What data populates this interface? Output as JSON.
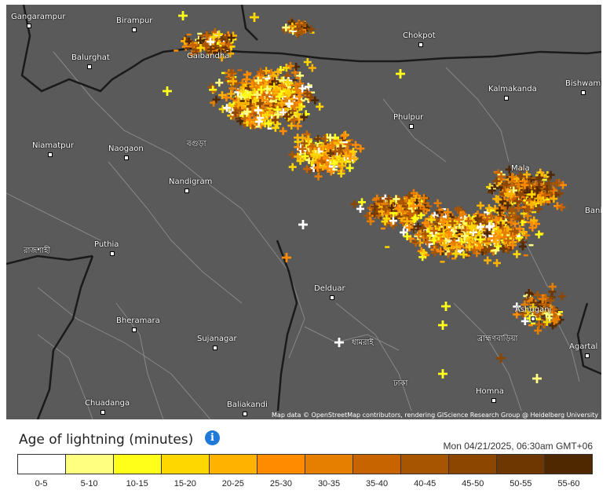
{
  "map": {
    "attribution": "Map data © OpenStreetMap contributors, rendering GIScience Research Group @ Heidelberg University",
    "places": [
      {
        "label": "Gangarampur",
        "dot": true
      },
      {
        "label": "Birampur",
        "dot": true
      },
      {
        "label": "Balurghat",
        "dot": true
      },
      {
        "label": "Chokpot",
        "dot": true
      },
      {
        "label": "Kalmakanda",
        "dot": true
      },
      {
        "label": "Bishwamb",
        "dot": true
      },
      {
        "label": "Phulpur",
        "dot": true
      },
      {
        "label": "Niamatpur",
        "dot": true
      },
      {
        "label": "Naogaon",
        "dot": true
      },
      {
        "label": "Nandigram",
        "dot": true
      },
      {
        "label": "Puthia",
        "dot": true
      },
      {
        "label": "Delduar",
        "dot": true
      },
      {
        "label": "Bheramara",
        "dot": true
      },
      {
        "label": "Sujanagar",
        "dot": true
      },
      {
        "label": "Chuadanga",
        "dot": true
      },
      {
        "label": "Baliakandi",
        "dot": true
      },
      {
        "label": "Homna",
        "dot": true
      },
      {
        "label": "Agartal",
        "dot": true
      },
      {
        "label": "Ashuganj",
        "dot": true
      },
      {
        "label": "Bani",
        "dot": false
      },
      {
        "label": "Mala",
        "dot": false
      },
      {
        "label": "Gaibandha",
        "dot": false
      },
      {
        "label": "ঢাকা",
        "dot": false
      },
      {
        "label": "ধামরাই",
        "dot": false
      },
      {
        "label": "রাজশাহী",
        "dot": false
      },
      {
        "label": "বগুড়া",
        "dot": false
      },
      {
        "label": "ব্রাহ্মণবাড়িয়া",
        "dot": false
      }
    ]
  },
  "legend": {
    "title": "Age of lightning (minutes)",
    "info_icon": "info-icon",
    "timestamp": "Mon 04/21/2025, 06:30am GMT+06",
    "bins": [
      {
        "label": "0-5",
        "color": "#ffffff"
      },
      {
        "label": "5-10",
        "color": "#ffff80"
      },
      {
        "label": "10-15",
        "color": "#ffff1a"
      },
      {
        "label": "15-20",
        "color": "#ffd700"
      },
      {
        "label": "20-25",
        "color": "#ffb300"
      },
      {
        "label": "25-30",
        "color": "#ff8c00"
      },
      {
        "label": "30-35",
        "color": "#e67e00"
      },
      {
        "label": "35-40",
        "color": "#c86400"
      },
      {
        "label": "40-45",
        "color": "#a85500"
      },
      {
        "label": "45-50",
        "color": "#8c4600"
      },
      {
        "label": "50-55",
        "color": "#6e3600"
      },
      {
        "label": "55-60",
        "color": "#502800"
      }
    ]
  }
}
